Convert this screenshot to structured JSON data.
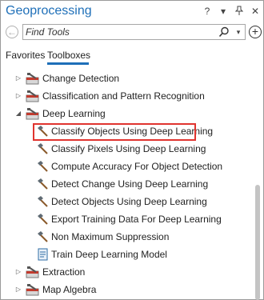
{
  "window": {
    "title": "Geoprocessing"
  },
  "title_icons": [
    "?",
    "▾",
    "📌",
    "✕"
  ],
  "toolbar": {
    "search_placeholder": "Find Tools",
    "search_dropdown": "▾",
    "back": "←",
    "add": "+"
  },
  "tabs": [
    {
      "label": "Favorites"
    },
    {
      "label": "Toolboxes"
    }
  ],
  "tree": {
    "items": [
      {
        "label": "Change Detection",
        "expander": "▷",
        "icon": "toolbox-icon"
      },
      {
        "label": "Classification and Pattern Recognition",
        "expander": "▷",
        "icon": "toolbox-icon"
      },
      {
        "label": "Deep Learning",
        "expander": "◢",
        "icon": "toolbox-icon"
      },
      {
        "label": "Classify Objects Using Deep Learning",
        "icon": "hammer-icon"
      },
      {
        "label": "Classify Pixels Using Deep Learning",
        "icon": "hammer-icon"
      },
      {
        "label": "Compute Accuracy For Object Detection",
        "icon": "hammer-icon"
      },
      {
        "label": "Detect Change Using Deep Learning",
        "icon": "hammer-icon"
      },
      {
        "label": "Detect Objects Using Deep Learning",
        "icon": "hammer-icon"
      },
      {
        "label": "Export Training Data For Deep Learning",
        "icon": "hammer-icon"
      },
      {
        "label": "Non Maximum Suppression",
        "icon": "hammer-icon"
      },
      {
        "label": "Train Deep Learning Model",
        "icon": "script-icon"
      },
      {
        "label": "Extraction",
        "expander": "▷",
        "icon": "toolbox-icon"
      },
      {
        "label": "Map Algebra",
        "expander": "▷",
        "icon": "toolbox-icon"
      }
    ]
  },
  "colors": {
    "accent": "#1e6fb8",
    "highlight": "#e0342f"
  }
}
